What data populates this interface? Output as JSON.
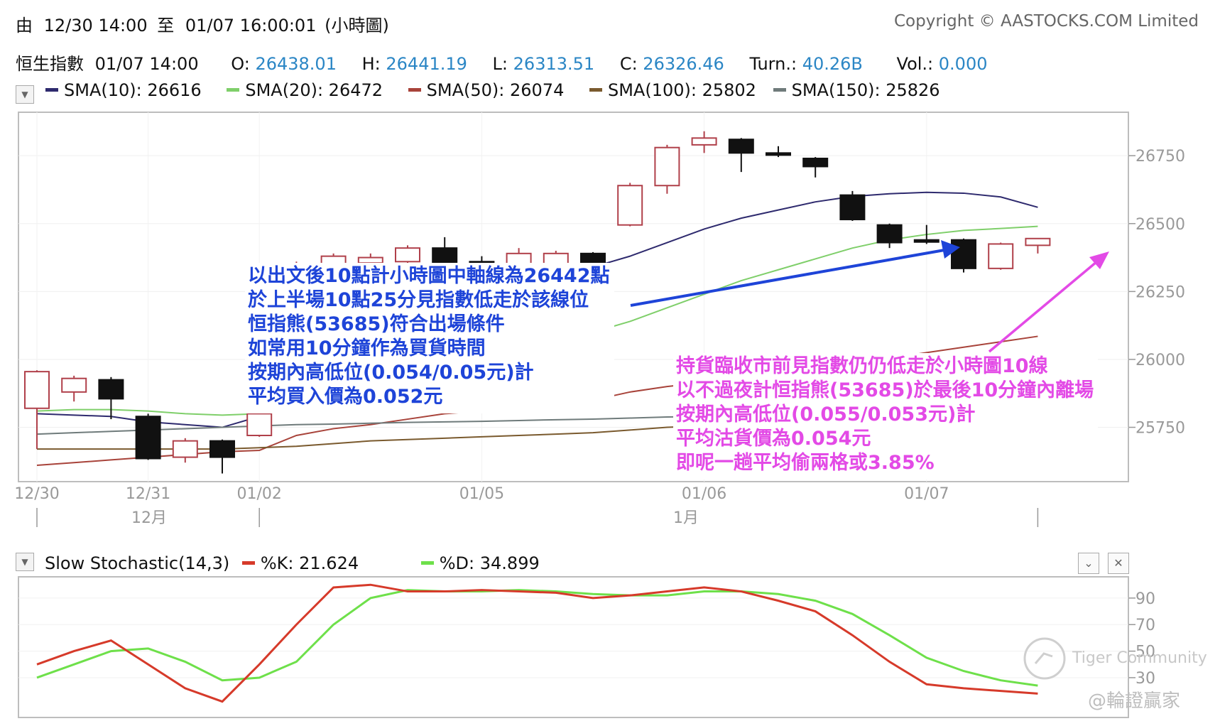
{
  "header": {
    "range_from_label": "由",
    "range_from": "12/30 14:00",
    "range_to_label": "至",
    "range_to": "01/07 16:00:01",
    "range_suffix": "(小時圖)",
    "copyright": "Copyright © AASTOCKS.COM Limited"
  },
  "quote": {
    "name": "恒生指數",
    "time": "01/07 14:00",
    "open_label": "O:",
    "open": "26438.01",
    "high_label": "H:",
    "high": "26441.19",
    "low_label": "L:",
    "low": "26313.51",
    "close_label": "C:",
    "close": "26326.46",
    "turnover_label": "Turn.:",
    "turnover": "40.26B",
    "volume_label": "Vol.:",
    "volume": "0.000"
  },
  "sma_legend": [
    {
      "label": "SMA(10): 26616",
      "color": "#2e2a6e"
    },
    {
      "label": "SMA(20): 26472",
      "color": "#7fcf6a"
    },
    {
      "label": "SMA(50): 26074",
      "color": "#a8433a"
    },
    {
      "label": "SMA(100): 25802",
      "color": "#7a5a2e"
    },
    {
      "label": "SMA(150): 25826",
      "color": "#6f7b7b"
    }
  ],
  "stoch_legend": {
    "title": "Slow Stochastic(14,3)",
    "k_label": "%K: 21.624",
    "d_label": "%D: 34.899",
    "k_color": "#d63a2a",
    "d_color": "#6ee04a"
  },
  "annotations": {
    "blue_lines": [
      "以出文後10點計小時圖中軸線為26442點",
      "於上半場10點25分見指數低走於該線位",
      "恒指熊(53685)符合出場條件",
      "如常用10分鐘作為買貨時間",
      "按期內高低位(0.054/0.05元)計",
      "平均買入價為0.052元"
    ],
    "pink_lines": [
      "持貨臨收市前見指數仍仍低走於小時圖10線",
      "以不過夜計恒指熊(53685)於最後10分鐘內離場",
      "按期內高低位(0.055/0.053元)計",
      "平均沽貨價為0.054元",
      "即呢一趟平均偷兩格或3.85%"
    ],
    "blue_color": "#1e44d8",
    "pink_color": "#e34ae6"
  },
  "watermark": {
    "brand": "Tiger Community",
    "author": "@輪證贏家"
  },
  "icons": {
    "dropdown_main": "dropdown-arrow-icon",
    "dropdown_stoch": "dropdown-arrow-icon",
    "collapse": "chevron-down-icon",
    "close": "close-icon"
  },
  "chart_data": [
    {
      "type": "candlestick",
      "title": "恒生指數",
      "x_ticks": [
        "12/30",
        "12/31",
        "01/02",
        "01/05",
        "01/06",
        "01/07"
      ],
      "x_month_labels": [
        "12月",
        "1月"
      ],
      "y_ticks": [
        25750,
        26000,
        26250,
        26500,
        26750
      ],
      "ylim": [
        25550,
        26910
      ],
      "up_color": "#b0404a",
      "down_color": "#111111",
      "candles": [
        {
          "o": 25820,
          "h": 25960,
          "l": 25670,
          "c": 25955
        },
        {
          "o": 25880,
          "h": 25940,
          "l": 25845,
          "c": 25930
        },
        {
          "o": 25925,
          "h": 25935,
          "l": 25780,
          "c": 25855
        },
        {
          "o": 25790,
          "h": 25800,
          "l": 25630,
          "c": 25635
        },
        {
          "o": 25640,
          "h": 25710,
          "l": 25620,
          "c": 25700
        },
        {
          "o": 25700,
          "h": 25705,
          "l": 25580,
          "c": 25640
        },
        {
          "o": 25720,
          "h": 25805,
          "l": 25715,
          "c": 25800
        },
        {
          "o": 26270,
          "h": 26360,
          "l": 26260,
          "c": 26345
        },
        {
          "o": 26300,
          "h": 26390,
          "l": 26290,
          "c": 26380
        },
        {
          "o": 26355,
          "h": 26390,
          "l": 26320,
          "c": 26375
        },
        {
          "o": 26360,
          "h": 26420,
          "l": 26345,
          "c": 26410
        },
        {
          "o": 26410,
          "h": 26450,
          "l": 26330,
          "c": 26350
        },
        {
          "o": 26360,
          "h": 26380,
          "l": 26290,
          "c": 26350
        },
        {
          "o": 26350,
          "h": 26410,
          "l": 26320,
          "c": 26390
        },
        {
          "o": 26350,
          "h": 26400,
          "l": 26340,
          "c": 26390
        },
        {
          "o": 26390,
          "h": 26395,
          "l": 26310,
          "c": 26350
        },
        {
          "o": 26495,
          "h": 26650,
          "l": 26490,
          "c": 26640
        },
        {
          "o": 26640,
          "h": 26790,
          "l": 26610,
          "c": 26780
        },
        {
          "o": 26790,
          "h": 26840,
          "l": 26760,
          "c": 26815
        },
        {
          "o": 26810,
          "h": 26815,
          "l": 26690,
          "c": 26760
        },
        {
          "o": 26760,
          "h": 26785,
          "l": 26745,
          "c": 26755
        },
        {
          "o": 26740,
          "h": 26745,
          "l": 26670,
          "c": 26710
        },
        {
          "o": 26605,
          "h": 26620,
          "l": 26510,
          "c": 26515
        },
        {
          "o": 26495,
          "h": 26500,
          "l": 26410,
          "c": 26430
        },
        {
          "o": 26440,
          "h": 26495,
          "l": 26425,
          "c": 26435
        },
        {
          "o": 26440,
          "h": 26445,
          "l": 26320,
          "c": 26335
        },
        {
          "o": 26335,
          "h": 26430,
          "l": 26330,
          "c": 26425
        },
        {
          "o": 26420,
          "h": 26445,
          "l": 26390,
          "c": 26445
        }
      ],
      "sma": [
        {
          "name": "SMA(10)",
          "color": "#2e2a6e",
          "values": [
            25800,
            25795,
            25790,
            25770,
            25760,
            25750,
            25790,
            25990,
            26190,
            26250,
            26290,
            26310,
            26320,
            26330,
            26335,
            26340,
            26380,
            26430,
            26480,
            26520,
            26550,
            26580,
            26600,
            26610,
            26615,
            26612,
            26598,
            26560
          ]
        },
        {
          "name": "SMA(20)",
          "color": "#7fcf6a",
          "values": [
            25810,
            25815,
            25815,
            25810,
            25800,
            25795,
            25800,
            25870,
            25920,
            25970,
            26010,
            26050,
            26070,
            26080,
            26090,
            26100,
            26140,
            26190,
            26240,
            26290,
            26330,
            26370,
            26410,
            26440,
            26460,
            26475,
            26482,
            26490
          ]
        },
        {
          "name": "SMA(50)",
          "color": "#a8433a",
          "values": [
            25610,
            25620,
            25630,
            25640,
            25650,
            25660,
            25665,
            25720,
            25745,
            25760,
            25780,
            25800,
            25810,
            25825,
            25840,
            25850,
            25880,
            25900,
            25915,
            25930,
            25950,
            25965,
            25990,
            26005,
            26025,
            26045,
            26065,
            26085
          ]
        },
        {
          "name": "SMA(100)",
          "color": "#7a5a2e",
          "values": [
            25670,
            25670,
            25670,
            25670,
            25670,
            25670,
            25675,
            25680,
            25690,
            25700,
            25705,
            25710,
            25715,
            25720,
            25725,
            25730,
            25740,
            25750,
            25755,
            25760,
            25765,
            25770,
            25780,
            25785,
            25790,
            25795,
            25800,
            25802
          ]
        },
        {
          "name": "SMA(150)",
          "color": "#6f7b7b",
          "values": [
            25725,
            25730,
            25735,
            25740,
            25745,
            25750,
            25755,
            25760,
            25762,
            25765,
            25768,
            25770,
            25772,
            25775,
            25778,
            25780,
            25784,
            25788,
            25790,
            25794,
            25798,
            25802,
            25806,
            25810,
            25815,
            25818,
            25822,
            25826
          ]
        }
      ]
    },
    {
      "type": "line",
      "title": "Slow Stochastic(14,3)",
      "y_ticks": [
        30,
        50,
        70,
        90
      ],
      "ylim": [
        0,
        106
      ],
      "series": [
        {
          "name": "%K",
          "color": "#d63a2a",
          "values": [
            40,
            50,
            58,
            40,
            22,
            12,
            40,
            70,
            98,
            100,
            95,
            95,
            96,
            95,
            94,
            90,
            92,
            95,
            98,
            95,
            88,
            80,
            62,
            42,
            25,
            22,
            20,
            18
          ]
        },
        {
          "name": "%D",
          "color": "#6ee04a",
          "values": [
            30,
            40,
            50,
            52,
            42,
            28,
            30,
            42,
            70,
            90,
            96,
            95,
            95,
            96,
            95,
            93,
            92,
            92,
            95,
            95,
            93,
            88,
            78,
            62,
            45,
            35,
            28,
            24
          ]
        }
      ]
    }
  ]
}
